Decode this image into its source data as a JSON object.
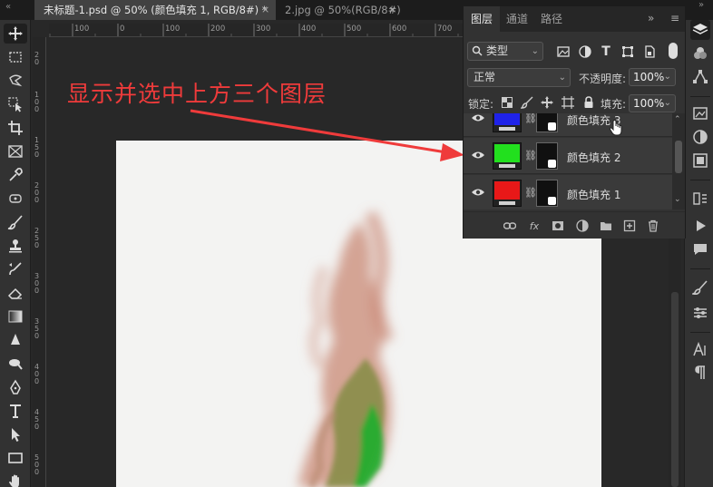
{
  "tabs": [
    {
      "label": "未标题-1.psd @ 50% (颜色填充 1, RGB/8#) *",
      "active": true
    },
    {
      "label": "2.jpg @ 50%(RGB/8#)",
      "active": false
    }
  ],
  "tab_close_glyph": "×",
  "collapse_glyph": "«",
  "collapse_right_glyph": "»",
  "ruler": {
    "top": [
      "100",
      "0",
      "100",
      "200",
      "300",
      "400",
      "500",
      "600",
      "700"
    ],
    "left": [
      [
        "2",
        "0"
      ],
      [
        "1",
        "0",
        "0"
      ],
      [
        "1",
        "5",
        "0"
      ],
      [
        "2",
        "0",
        "0"
      ],
      [
        "2",
        "5",
        "0"
      ],
      [
        "3",
        "0",
        "0"
      ],
      [
        "3",
        "5",
        "0"
      ],
      [
        "4",
        "0",
        "0"
      ],
      [
        "4",
        "5",
        "0"
      ],
      [
        "5",
        "0",
        "0"
      ],
      [
        "5",
        "5",
        "0"
      ]
    ]
  },
  "annotation": {
    "text": "显示并选中上方三个图层",
    "color": "#ef3b3b"
  },
  "layers_panel": {
    "tabs": [
      "图层",
      "通道",
      "路径"
    ],
    "menu_glyphs": {
      "collapse": "»",
      "menu": "≡"
    },
    "filter": {
      "label": "类型",
      "icons": [
        "image-filter-icon",
        "adjustment-filter-icon",
        "type-filter-icon",
        "shape-filter-icon",
        "smartobject-filter-icon"
      ]
    },
    "type_icon_glyph": "T",
    "blend_mode": "正常",
    "opacity_label": "不透明度:",
    "opacity_value": "100%",
    "lock_label": "锁定:",
    "fill_label": "填充:",
    "fill_value": "100%",
    "chevron": "⌄",
    "layers": [
      {
        "name": "颜色填充 3",
        "color": "#1f22e8",
        "visible": true
      },
      {
        "name": "颜色填充 2",
        "color": "#22e01e",
        "visible": true
      },
      {
        "name": "颜色填充 1",
        "color": "#e81818",
        "visible": true
      }
    ],
    "fx_label": "fx",
    "scroll_up": "⌃",
    "scroll_down": "⌄"
  },
  "colors": {
    "accent_annotation": "#ef3b3b",
    "panel_bg": "#323232",
    "canvas_bg": "#f3f3f2"
  }
}
